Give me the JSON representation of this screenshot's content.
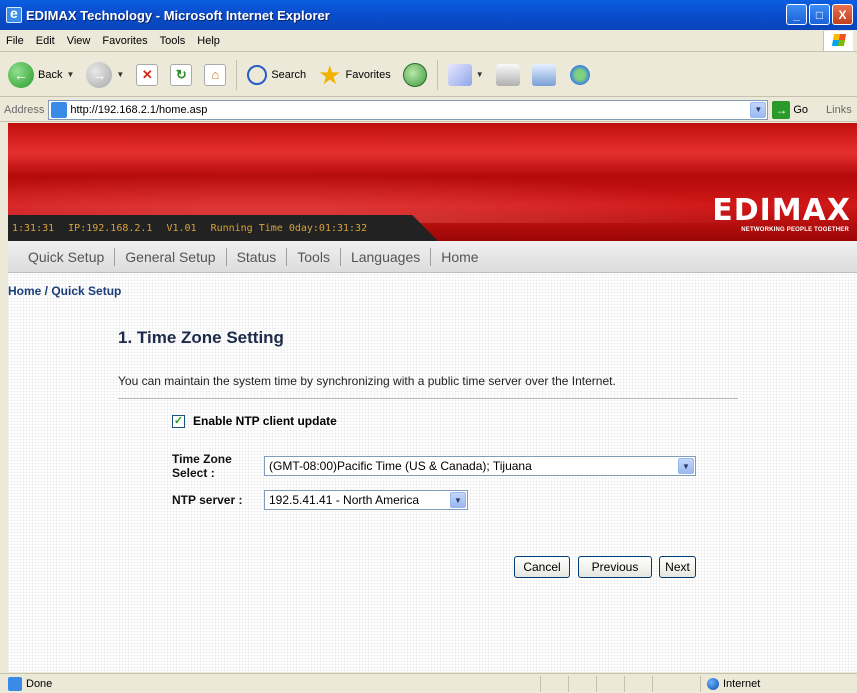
{
  "window": {
    "title": "EDIMAX Technology - Microsoft Internet Explorer",
    "buttons": [
      "_",
      "□",
      "X"
    ]
  },
  "menubar": [
    "File",
    "Edit",
    "View",
    "Favorites",
    "Tools",
    "Help"
  ],
  "toolbar": {
    "back": "Back",
    "search": "Search",
    "favorites": "Favorites"
  },
  "addressbar": {
    "label": "Address",
    "url": "http://192.168.2.1/home.asp",
    "go": "Go",
    "links": "Links"
  },
  "router": {
    "status": {
      "time": "1:31:31",
      "ip": "IP:192.168.2.1",
      "version": "V1.01",
      "running": "Running Time 0day:01:31:32"
    },
    "logo": "EDIMAX",
    "tagline": "NETWORKING PEOPLE TOGETHER",
    "nav": [
      "Quick Setup",
      "General Setup",
      "Status",
      "Tools",
      "Languages",
      "Home"
    ],
    "breadcrumb": "Home / Quick Setup",
    "section_title": "1. Time Zone Setting",
    "description": "You can maintain the system time by synchronizing with a public time server over the Internet.",
    "ntp_enable_label": "Enable NTP client update",
    "ntp_enabled": true,
    "timezone_label": "Time Zone Select :",
    "timezone_value": "(GMT-08:00)Pacific Time (US & Canada); Tijuana",
    "ntp_server_label": "NTP server :",
    "ntp_server_value": "192.5.41.41 - North America",
    "buttons": {
      "cancel": "Cancel",
      "previous": "Previous",
      "next": "Next"
    }
  },
  "statusbar": {
    "text": "Done",
    "zone": "Internet"
  }
}
